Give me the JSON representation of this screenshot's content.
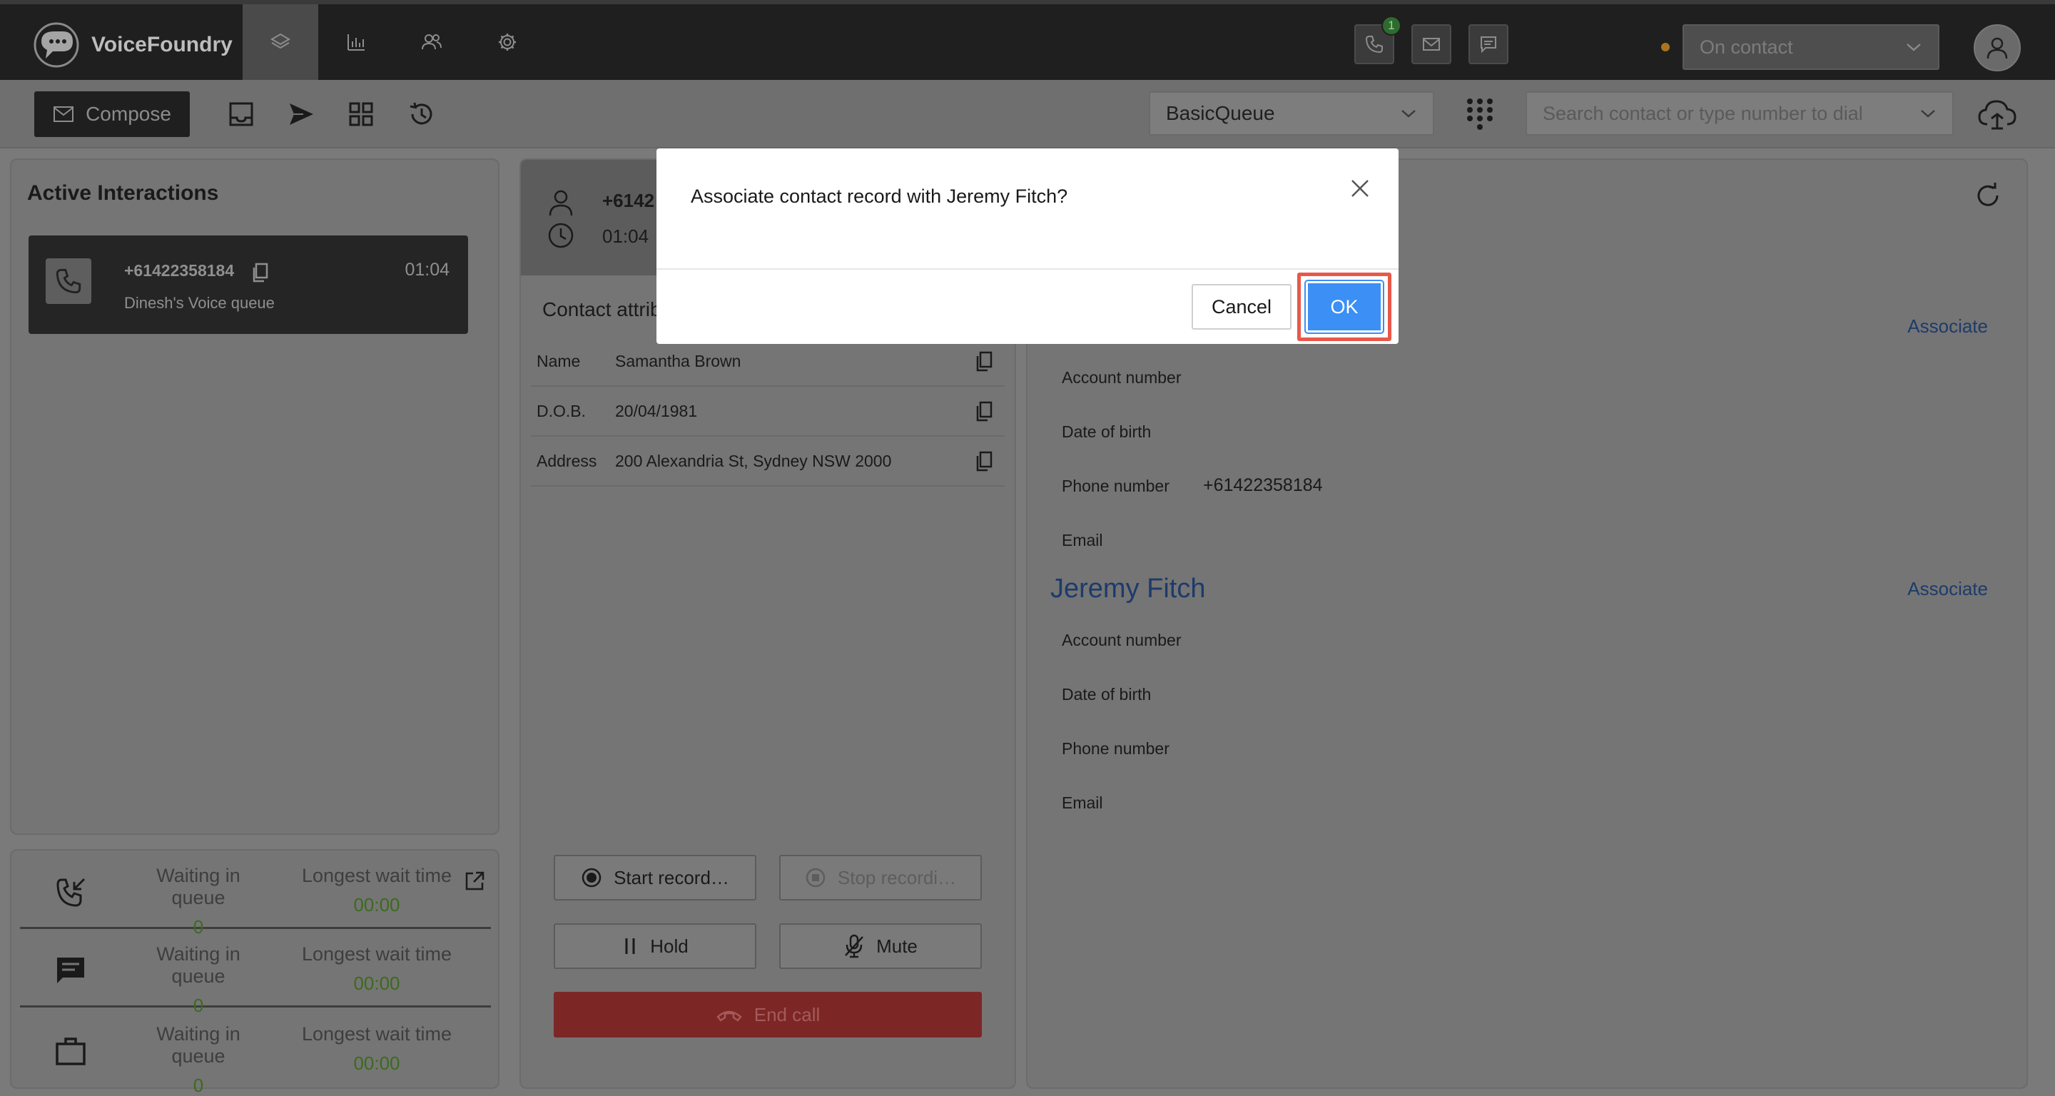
{
  "app": {
    "name": "VoiceFoundry"
  },
  "status": {
    "value": "On contact",
    "dot_color": "#a9761e"
  },
  "channels": {
    "voice_badge": "1"
  },
  "toolbar": {
    "compose_label": "Compose",
    "queue": "BasicQueue",
    "search_placeholder": "Search contact or type number to dial"
  },
  "active_interactions": {
    "title": "Active Interactions",
    "items": [
      {
        "number": "+61422358184",
        "queue": "Dinesh's Voice queue",
        "time": "01:04"
      }
    ]
  },
  "queue_stats": [
    {
      "icon": "incoming-call-icon",
      "waiting_label": "Waiting in queue",
      "waiting_value": "0",
      "longest_label": "Longest wait time",
      "longest_value": "00:00"
    },
    {
      "icon": "chat-icon",
      "waiting_label": "Waiting in queue",
      "waiting_value": "0",
      "longest_label": "Longest wait time",
      "longest_value": "00:00"
    },
    {
      "icon": "briefcase-icon",
      "waiting_label": "Waiting in queue",
      "waiting_value": "0",
      "longest_label": "Longest wait time",
      "longest_value": "00:00"
    }
  ],
  "contact": {
    "number": "+6142",
    "time": "01:04",
    "attributes_title": "Contact attrib",
    "attributes": [
      {
        "key": "Name",
        "value": "Samantha Brown"
      },
      {
        "key": "D.O.B.",
        "value": "20/04/1981"
      },
      {
        "key": "Address",
        "value": "200 Alexandria St, Sydney NSW 2000"
      }
    ]
  },
  "call_controls": {
    "start_record": "Start record…",
    "stop_record": "Stop recordi…",
    "hold": "Hold",
    "mute": "Mute",
    "end_call": "End call"
  },
  "matches": [
    {
      "name": "",
      "associate_label": "Associate",
      "fields": [
        {
          "label": "Account number",
          "value": ""
        },
        {
          "label": "Date of birth",
          "value": ""
        },
        {
          "label": "Phone number",
          "value": "+61422358184"
        },
        {
          "label": "Email",
          "value": ""
        }
      ]
    },
    {
      "name": "Jeremy Fitch",
      "associate_label": "Associate",
      "fields": [
        {
          "label": "Account number",
          "value": ""
        },
        {
          "label": "Date of birth",
          "value": ""
        },
        {
          "label": "Phone number",
          "value": ""
        },
        {
          "label": "Email",
          "value": ""
        }
      ]
    }
  ],
  "modal": {
    "title": "Associate contact record with Jeremy Fitch?",
    "cancel_label": "Cancel",
    "ok_label": "OK",
    "ok_color": "#3b8ff5",
    "highlight_color": "#e8584a"
  }
}
